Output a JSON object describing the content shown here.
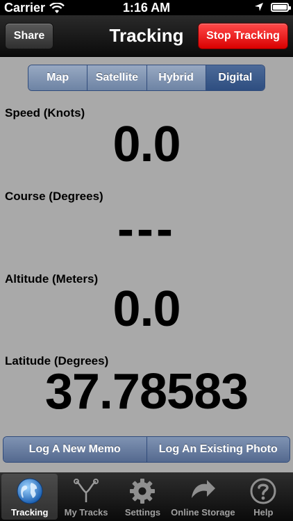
{
  "status_bar": {
    "carrier": "Carrier",
    "time": "1:16 AM"
  },
  "nav": {
    "share_label": "Share",
    "title": "Tracking",
    "stop_label": "Stop Tracking"
  },
  "map_modes": [
    {
      "label": "Map",
      "selected": false
    },
    {
      "label": "Satellite",
      "selected": false
    },
    {
      "label": "Hybrid",
      "selected": false
    },
    {
      "label": "Digital",
      "selected": true
    }
  ],
  "readouts": {
    "speed": {
      "label": "Speed (Knots)",
      "value": "0.0"
    },
    "course": {
      "label": "Course (Degrees)",
      "value": "---"
    },
    "altitude": {
      "label": "Altitude (Meters)",
      "value": "0.0"
    },
    "latitude": {
      "label": "Latitude (Degrees)",
      "value": "37.78583"
    }
  },
  "actions": {
    "new_memo": "Log A New Memo",
    "existing_photo": "Log An Existing Photo"
  },
  "tabs": [
    {
      "label": "Tracking",
      "icon": "globe-icon",
      "selected": true
    },
    {
      "label": "My Tracks",
      "icon": "tracks-icon",
      "selected": false
    },
    {
      "label": "Settings",
      "icon": "gear-icon",
      "selected": false
    },
    {
      "label": "Online Storage",
      "icon": "upload-arrow-icon",
      "selected": false
    },
    {
      "label": "Help",
      "icon": "help-icon",
      "selected": false
    }
  ]
}
